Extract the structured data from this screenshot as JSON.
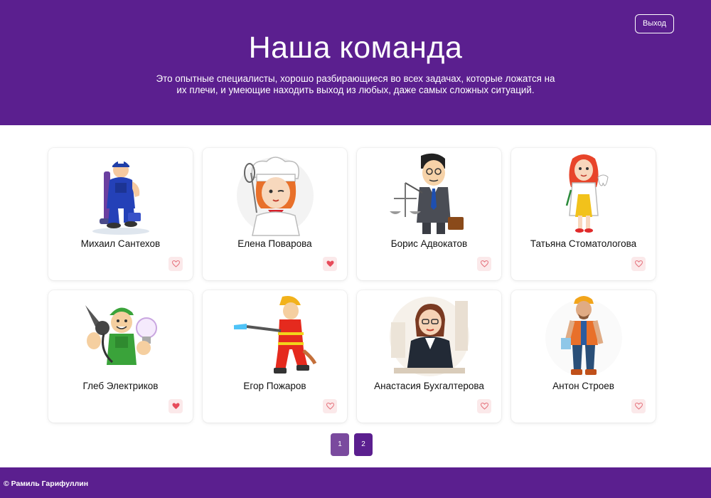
{
  "header": {
    "title": "Наша команда",
    "subtitle": "Это опытные специалисты, хорошо разбирающиеся во всех задачах, которые ложатся на их плечи, и умеющие находить выход из любых, даже самых сложных ситуаций.",
    "logout_label": "Выход",
    "background": "#5b1f8f"
  },
  "team": [
    {
      "name": "Михаил Сантехов",
      "liked": false,
      "icon": "plumber-avatar"
    },
    {
      "name": "Елена Поварова",
      "liked": true,
      "icon": "chef-avatar"
    },
    {
      "name": "Борис Адвокатов",
      "liked": false,
      "icon": "lawyer-avatar"
    },
    {
      "name": "Татьяна Стоматологова",
      "liked": false,
      "icon": "dentist-avatar"
    },
    {
      "name": "Глеб Электриков",
      "liked": true,
      "icon": "electrician-avatar"
    },
    {
      "name": "Егор Пожаров",
      "liked": false,
      "icon": "firefighter-avatar"
    },
    {
      "name": "Анастасия Бухгалтерова",
      "liked": false,
      "icon": "accountant-avatar"
    },
    {
      "name": "Антон Строев",
      "liked": false,
      "icon": "builder-avatar"
    }
  ],
  "pagination": {
    "pages": [
      "1",
      "2"
    ],
    "current": "2",
    "colors": {
      "inactive": "#7a4a9e",
      "active": "#5b1f8f"
    }
  },
  "footer": {
    "text": "© Рамиль Гарифуллин"
  },
  "colors": {
    "like_active": "#e74c5b",
    "like_inactive": "#e5737d",
    "like_bg": "#fbe9ea"
  }
}
